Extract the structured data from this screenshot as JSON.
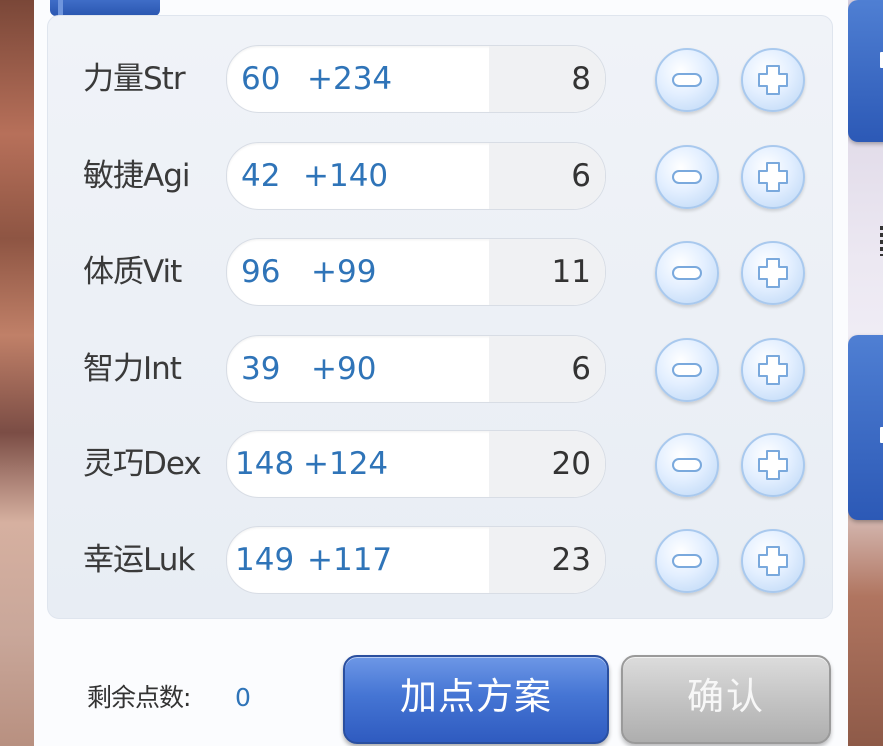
{
  "stats": [
    {
      "label": "力量Str",
      "base": "60",
      "bonus": "+234",
      "cost": "8"
    },
    {
      "label": "敏捷Agi",
      "base": "42",
      "bonus": "+140",
      "cost": "6"
    },
    {
      "label": "体质Vit",
      "base": "96",
      "bonus": "+99",
      "cost": "11"
    },
    {
      "label": "智力Int",
      "base": "39",
      "bonus": "+90",
      "cost": "6"
    },
    {
      "label": "灵巧Dex",
      "base": "148",
      "bonus": "+124",
      "cost": "20"
    },
    {
      "label": "幸运Luk",
      "base": "149",
      "bonus": "+117",
      "cost": "23"
    }
  ],
  "footer": {
    "remaining_label": "剩余点数:",
    "remaining_value": "0",
    "plan_button": "加点方案",
    "confirm_button": "确认"
  },
  "icons": {
    "minus": "minus-circle-icon",
    "plus": "plus-circle-icon"
  },
  "colors": {
    "value_blue": "#2f74b8",
    "button_blue": "#4575d4",
    "button_gray": "#c4c4c4"
  }
}
